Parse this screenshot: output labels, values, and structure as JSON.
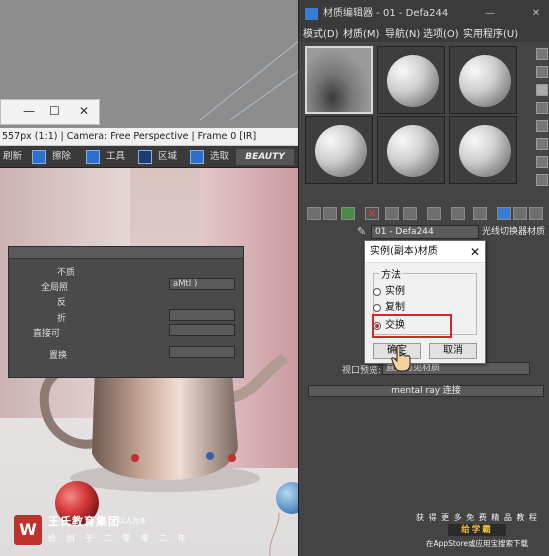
{
  "background_window": {
    "minimize": "—",
    "maximize": "☐",
    "close": "✕"
  },
  "frame_window": {
    "title": "557px (1:1) | Camera: Free Perspective | Frame 0 [IR]",
    "toolbar": {
      "refresh": "刷新",
      "erase": "擦除",
      "tools": "工具",
      "region": "区域",
      "select": "选取",
      "beauty": "BEAUTY"
    }
  },
  "material_editor": {
    "title": "材质编辑器 - 01 - Defa244",
    "window_controls": {
      "minimize": "—",
      "close": "✕"
    },
    "menu": [
      "模式(D)",
      "材质(M)",
      "导航(N)",
      "选项(O)",
      "实用程序(U)"
    ],
    "material_name": "01 - Defa244",
    "material_type": "光线切换器材质",
    "params": {
      "label_1": "不质",
      "label_2": "全局照",
      "label_3": "反",
      "label_4": "折",
      "label_5": "直接可",
      "field_right": "aMtl )",
      "label_6": "置换",
      "viewport_label": "视口预览:",
      "viewport_value": "直接可见材质"
    },
    "mental_ray_rollout": "mental ray 连接"
  },
  "dialog": {
    "title": "实例(副本)材质",
    "close": "✕",
    "group_label": "方法",
    "options": [
      "实例",
      "复制",
      "交换"
    ],
    "selected_option": "交换",
    "ok": "确定",
    "cancel": "取消"
  },
  "branding": {
    "left_logo": "W",
    "left_name": "王氏教育集团",
    "left_motto": "以人为本",
    "left_sub": "给 创 于 二 零 零 二 年",
    "right_line1": "获 得 更 多 免 费 精 品 教 程",
    "right_line2": "给学霸",
    "right_line3": "在AppStore或应用宝搜索下载"
  },
  "colors": {
    "accent_red": "#d62626",
    "editor_bg": "#444444",
    "brand_red": "#c0302c"
  }
}
